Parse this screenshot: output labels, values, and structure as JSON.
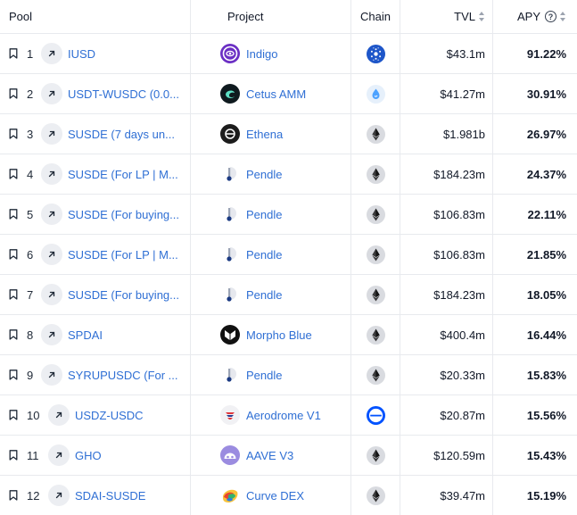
{
  "header": {
    "pool": "Pool",
    "project": "Project",
    "chain": "Chain",
    "tvl": "TVL",
    "apy": "APY",
    "help_glyph": "?"
  },
  "rows": [
    {
      "rank": "1",
      "pool": "IUSD",
      "project": "Indigo",
      "project_icon": "indigo-icon",
      "chain_icon": "cardano-icon",
      "tvl": "$43.1m",
      "apy": "91.22%"
    },
    {
      "rank": "2",
      "pool": "USDT-WUSDC (0.0...",
      "project": "Cetus AMM",
      "project_icon": "cetus-icon",
      "chain_icon": "sui-icon",
      "tvl": "$41.27m",
      "apy": "30.91%"
    },
    {
      "rank": "3",
      "pool": "SUSDE (7 days un...",
      "project": "Ethena",
      "project_icon": "ethena-icon",
      "chain_icon": "ethereum-icon",
      "tvl": "$1.981b",
      "apy": "26.97%"
    },
    {
      "rank": "4",
      "pool": "SUSDE (For LP | M...",
      "project": "Pendle",
      "project_icon": "pendle-icon",
      "chain_icon": "ethereum-icon",
      "tvl": "$184.23m",
      "apy": "24.37%"
    },
    {
      "rank": "5",
      "pool": "SUSDE (For buying...",
      "project": "Pendle",
      "project_icon": "pendle-icon",
      "chain_icon": "ethereum-icon",
      "tvl": "$106.83m",
      "apy": "22.11%"
    },
    {
      "rank": "6",
      "pool": "SUSDE (For LP | M...",
      "project": "Pendle",
      "project_icon": "pendle-icon",
      "chain_icon": "ethereum-icon",
      "tvl": "$106.83m",
      "apy": "21.85%"
    },
    {
      "rank": "7",
      "pool": "SUSDE (For buying...",
      "project": "Pendle",
      "project_icon": "pendle-icon",
      "chain_icon": "ethereum-icon",
      "tvl": "$184.23m",
      "apy": "18.05%"
    },
    {
      "rank": "8",
      "pool": "SPDAI",
      "project": "Morpho Blue",
      "project_icon": "morpho-icon",
      "chain_icon": "ethereum-icon",
      "tvl": "$400.4m",
      "apy": "16.44%"
    },
    {
      "rank": "9",
      "pool": "SYRUPUSDC (For ...",
      "project": "Pendle",
      "project_icon": "pendle-icon",
      "chain_icon": "ethereum-icon",
      "tvl": "$20.33m",
      "apy": "15.83%"
    },
    {
      "rank": "10",
      "pool": "USDZ-USDC",
      "project": "Aerodrome V1",
      "project_icon": "aerodrome-icon",
      "chain_icon": "base-icon",
      "tvl": "$20.87m",
      "apy": "15.56%"
    },
    {
      "rank": "11",
      "pool": "GHO",
      "project": "AAVE V3",
      "project_icon": "aave-icon",
      "chain_icon": "ethereum-icon",
      "tvl": "$120.59m",
      "apy": "15.43%"
    },
    {
      "rank": "12",
      "pool": "SDAI-SUSDE",
      "project": "Curve DEX",
      "project_icon": "curve-icon",
      "chain_icon": "ethereum-icon",
      "tvl": "$39.47m",
      "apy": "15.19%"
    }
  ],
  "colors": {
    "link": "#2f6fd4",
    "border": "#e8eaee",
    "text": "#111827"
  }
}
